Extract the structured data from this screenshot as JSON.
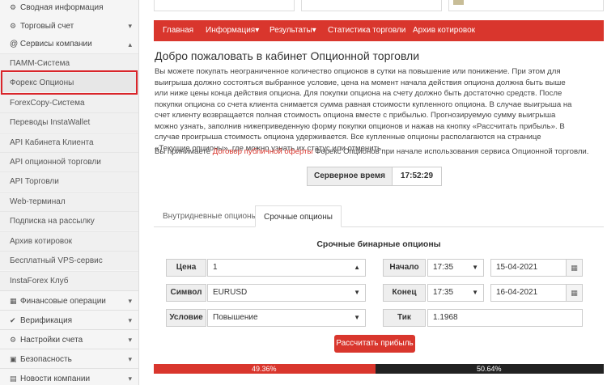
{
  "sidebar": {
    "items": [
      {
        "label": "Сводная информация",
        "icon": "gear-icon",
        "glyph": "⚙",
        "caret": ""
      },
      {
        "label": "Торговый счет",
        "icon": "gear-icon",
        "glyph": "⚙",
        "caret": "▾"
      },
      {
        "label": "@ Сервисы компании",
        "icon": "",
        "glyph": "",
        "caret": "▴"
      },
      {
        "label": "ПАММ-Система"
      },
      {
        "label": "Форекс Опционы"
      },
      {
        "label": "ForexCopy-Система"
      },
      {
        "label": "Переводы InstaWallet"
      },
      {
        "label": "API Кабинета Клиента"
      },
      {
        "label": "API опционной торговли"
      },
      {
        "label": "API Торговли"
      },
      {
        "label": "Web-терминал"
      },
      {
        "label": "Подписка на рассылку"
      },
      {
        "label": "Архив котировок"
      },
      {
        "label": "Бесплатный VPS-сервис"
      },
      {
        "label": "InstaForex Клуб"
      },
      {
        "label": "Финансовые операции",
        "glyph": "▦",
        "caret": "▾"
      },
      {
        "label": "Верификация",
        "glyph": "✔",
        "caret": "▾"
      },
      {
        "label": "Настройки счета",
        "glyph": "⚙",
        "caret": "▾"
      },
      {
        "label": "Безопасность",
        "glyph": "🔒",
        "caret": "▾"
      },
      {
        "label": "Новости компании",
        "glyph": "▤",
        "caret": "▾"
      }
    ]
  },
  "nav": {
    "items": [
      "Главная",
      "Информация▾",
      "Результаты▾",
      "Статистика торговли",
      "Архив котировок"
    ]
  },
  "page": {
    "title": "Добро пожаловать в кабинет Опционной торговли",
    "intro": "Вы можете покупать неограниченное количество опционов в сутки на повышение или понижение. При этом для выигрыша должно состояться выбранное условие, цена на момент начала действия опциона должна быть выше или ниже цены конца действия опциона. Для покупки опциона на счету должно быть достаточно средств. После покупки опциона со счета клиента снимается сумма равная стоимости купленного опциона. В случае выигрыша на счет клиенту возвращается полная стоимость опциона вместе с прибылью. Прогнозируемую сумму выигрыша можно узнать, заполнив нижеприведенную форму покупки опционов и нажав на кнопку «Рассчитать прибыль». В случае проигрыша стоимость опциона удерживается. Все купленные опционы располагаются на странице «Текущие опционы», где можно узнать их статус или отменить.",
    "accept_pre": "Вы принимаете ",
    "accept_link": "Договор публичной оферты",
    "accept_post": " Форекс Опционов при начале использования сервиса Опционной торговли."
  },
  "server": {
    "label": "Серверное время",
    "time": "17:52:29"
  },
  "tabs": {
    "intraday": "Внутридневные опционы",
    "term": "Срочные опционы"
  },
  "form": {
    "title": "Срочные бинарные опционы",
    "price_label": "Цена",
    "price_value": "1",
    "symbol_label": "Символ",
    "symbol_value": "EURUSD",
    "condition_label": "Условие",
    "condition_value": "Повышение",
    "start_label": "Начало",
    "start_time": "17:35",
    "start_date": "15-04-2021",
    "end_label": "Конец",
    "end_time": "17:35",
    "end_date": "16-04-2021",
    "tick_label": "Тик",
    "tick_value": "1.1968",
    "calc_button": "Рассчитать прибыль"
  },
  "ratio": {
    "left_label": "49.36%",
    "right_label": "50.64%",
    "left_fraction": 0.4936
  },
  "colors": {
    "accent": "#d9362d",
    "highlight": "#d9252a"
  }
}
